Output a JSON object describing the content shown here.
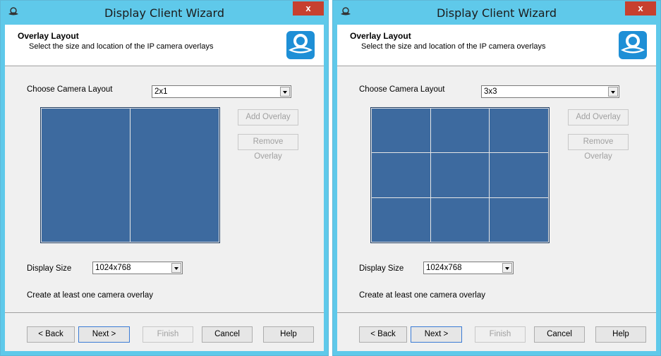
{
  "windows": [
    {
      "title": "Display Client Wizard",
      "close_label": "x",
      "header": {
        "title": "Overlay Layout",
        "subtitle": "Select the size and location of the IP camera overlays"
      },
      "camera_layout": {
        "label": "Choose Camera Layout",
        "value": "2x1",
        "rows": 1,
        "cols": 2
      },
      "add_overlay_label": "Add Overlay",
      "remove_overlay_label": "Remove Overlay",
      "display_size": {
        "label": "Display Size",
        "value": "1024x768"
      },
      "status": "Create at least one camera overlay",
      "buttons": {
        "back": "< Back",
        "next": "Next >",
        "finish": "Finish",
        "cancel": "Cancel",
        "help": "Help"
      }
    },
    {
      "title": "Display Client Wizard",
      "close_label": "x",
      "header": {
        "title": "Overlay Layout",
        "subtitle": "Select the size and location of the IP camera overlays"
      },
      "camera_layout": {
        "label": "Choose Camera Layout",
        "value": "3x3",
        "rows": 3,
        "cols": 3
      },
      "add_overlay_label": "Add Overlay",
      "remove_overlay_label": "Remove Overlay",
      "display_size": {
        "label": "Display Size",
        "value": "1024x768"
      },
      "status": "Create at least one camera overlay",
      "buttons": {
        "back": "< Back",
        "next": "Next >",
        "finish": "Finish",
        "cancel": "Cancel",
        "help": "Help"
      }
    }
  ],
  "colors": {
    "titlebar": "#5fc9ea",
    "close": "#c7402f",
    "overlay_fill": "#3d6a9f",
    "overlay_border": "#1f3d63"
  }
}
